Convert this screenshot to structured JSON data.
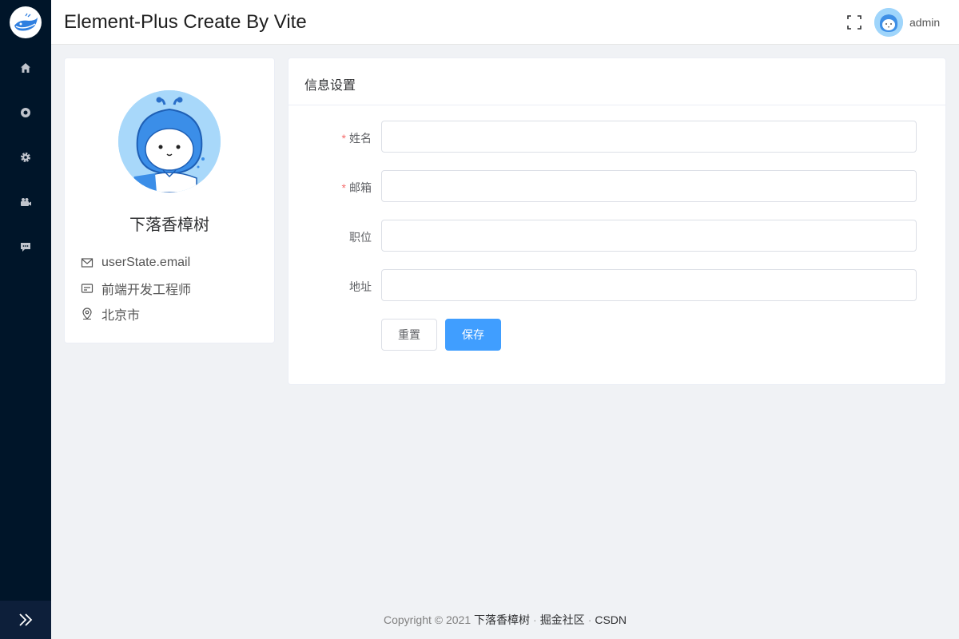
{
  "header": {
    "title": "Element-Plus Create By Vite",
    "username": "admin"
  },
  "sidebar": {
    "items": [
      {
        "icon": "home-icon"
      },
      {
        "icon": "lifebuoy-icon"
      },
      {
        "icon": "gear-icon"
      },
      {
        "icon": "camera-icon"
      },
      {
        "icon": "chat-icon"
      }
    ],
    "collapse_icon": "double-chevron-right-icon"
  },
  "profile": {
    "name": "下落香樟树",
    "email": "userState.email",
    "position": "前端开发工程师",
    "location": "北京市"
  },
  "settings": {
    "title": "信息设置",
    "fields": [
      {
        "label": "姓名",
        "required": true,
        "value": ""
      },
      {
        "label": "邮箱",
        "required": true,
        "value": ""
      },
      {
        "label": "职位",
        "required": false,
        "value": ""
      },
      {
        "label": "地址",
        "required": false,
        "value": ""
      }
    ],
    "reset_label": "重置",
    "save_label": "保存"
  },
  "footer": {
    "copyright": "Copyright © 2021",
    "links": [
      "下落香樟树",
      "掘金社区",
      "CSDN"
    ]
  },
  "colors": {
    "sidebar_bg": "#001529",
    "primary": "#409eff",
    "required": "#f56c6c"
  }
}
